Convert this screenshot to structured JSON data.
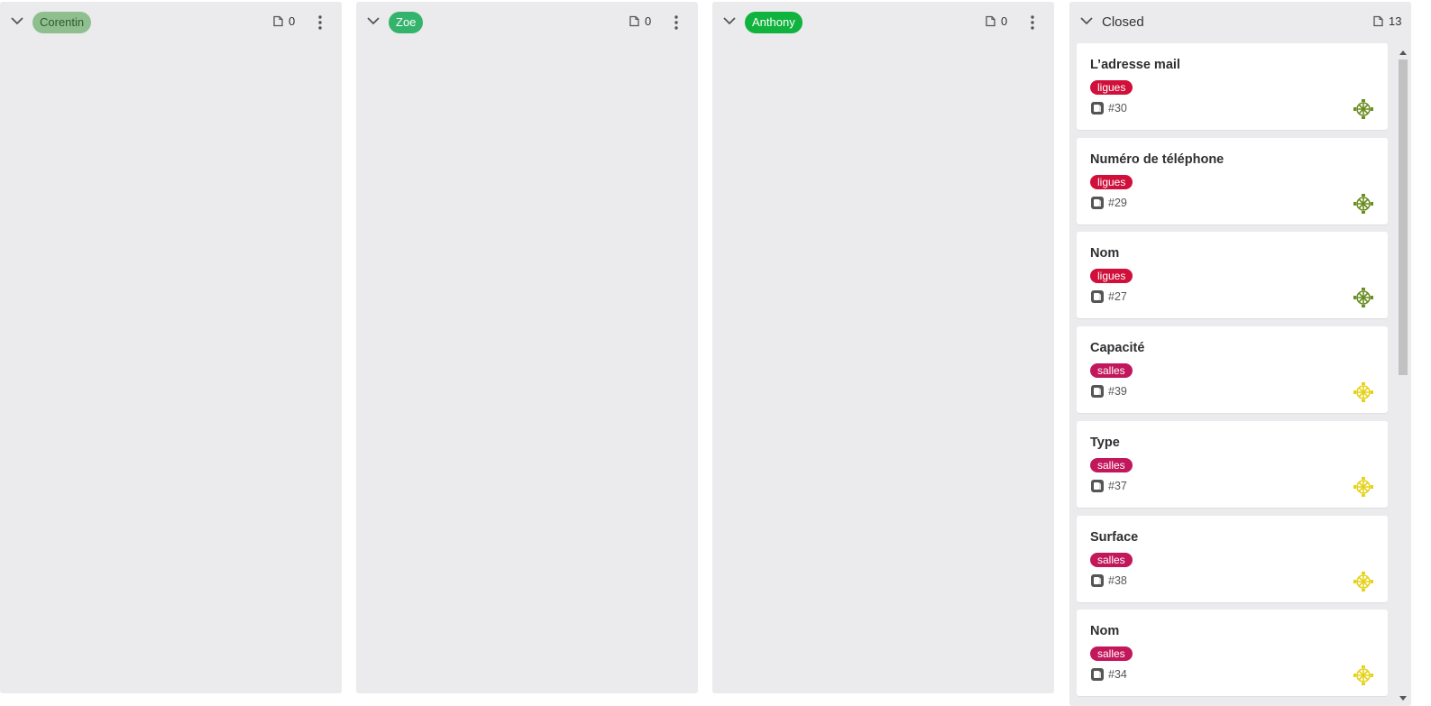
{
  "columns": [
    {
      "label": "Corentin",
      "label_bg": "#8fbf8f",
      "label_color": "#2f5a2f",
      "count": "0"
    },
    {
      "label": "Zoe",
      "label_bg": "#33b36b",
      "label_color": "#ffffff",
      "count": "0"
    },
    {
      "label": "Anthony",
      "label_bg": "#0fb33d",
      "label_color": "#ffffff",
      "count": "0"
    }
  ],
  "closed": {
    "title": "Closed",
    "count": "13",
    "cards": [
      {
        "title": "L’adresse mail",
        "tag": "ligues",
        "tag_color": "#d0103a",
        "number": "#30",
        "avatar_color": "#6b8e23"
      },
      {
        "title": "Numéro de téléphone",
        "tag": "ligues",
        "tag_color": "#d0103a",
        "number": "#29",
        "avatar_color": "#6b8e23"
      },
      {
        "title": "Nom",
        "tag": "ligues",
        "tag_color": "#d0103a",
        "number": "#27",
        "avatar_color": "#6b8e23"
      },
      {
        "title": "Capacité",
        "tag": "salles",
        "tag_color": "#c2185b",
        "number": "#39",
        "avatar_color": "#e6d21a"
      },
      {
        "title": "Type",
        "tag": "salles",
        "tag_color": "#c2185b",
        "number": "#37",
        "avatar_color": "#e6d21a"
      },
      {
        "title": "Surface",
        "tag": "salles",
        "tag_color": "#c2185b",
        "number": "#38",
        "avatar_color": "#e6d21a"
      },
      {
        "title": "Nom",
        "tag": "salles",
        "tag_color": "#c2185b",
        "number": "#34",
        "avatar_color": "#e6d21a"
      }
    ]
  },
  "icons": {
    "collapse": "chevron-down-icon",
    "issue_count": "issue-icon",
    "menu": "kebab-menu-icon",
    "issue_type": "issue-type-icon",
    "assignee": "avatar"
  }
}
